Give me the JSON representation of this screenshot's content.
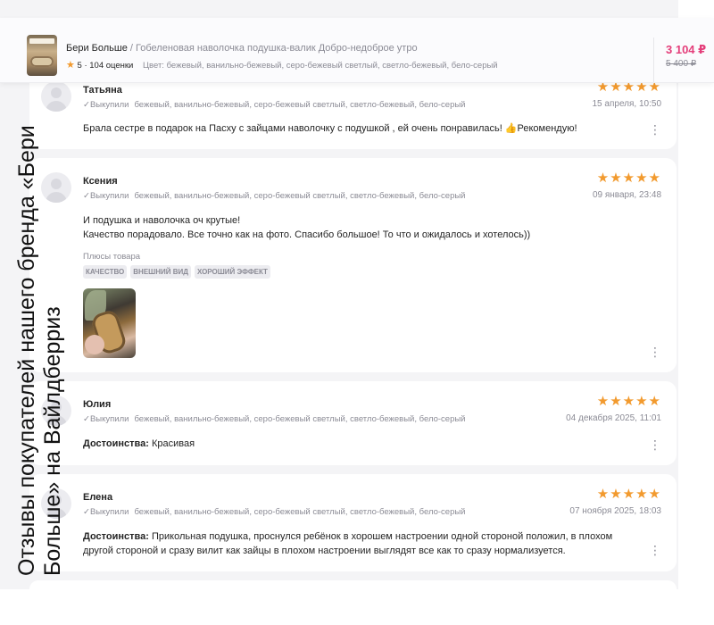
{
  "header": {
    "brand": "Бери Больше",
    "separator": " / ",
    "product": "Гобеленовая наволочка подушка-валик Добро-недоброе утро",
    "rating_star": "★",
    "rating": "5",
    "rating_dot": " · ",
    "reviews_count": "104 оценки",
    "color_label": "Цвет: бежевый, ванильно-бежевый, серо-бежевый светлый, светло-бежевый, бело-серый",
    "price": "3 104 ₽",
    "old_price": "5 400 ₽"
  },
  "reviews": [
    {
      "name": "Татьяна",
      "stars": "★★★★★",
      "bought_check": "✓",
      "bought": "Выкупили",
      "colors": "бежевый, ванильно-бежевый, серо-бежевый светлый, светло-бежевый, бело-серый",
      "date": "15 апреля, 10:50",
      "text": "Брала сестре в подарок на Пасху с зайцами наволочку с подушкой , ей очень понравилась! 👍Рекомендую!",
      "menu": "⋮"
    },
    {
      "name": "Ксения",
      "stars": "★★★★★",
      "bought_check": "✓",
      "bought": "Выкупили",
      "colors": "бежевый, ванильно-бежевый, серо-бежевый светлый, светло-бежевый, бело-серый",
      "date": "09 января, 23:48",
      "text_line1": "И подушка и наволочка оч крутые!",
      "text_line2": "Качество порадовало. Все точно как на фото. Спасибо большое! То что и ожидалось и хотелось))",
      "pros_label": "Плюсы товара",
      "tags": [
        "Качество",
        "Внешний вид",
        "Хороший эффект"
      ],
      "menu": "⋮"
    },
    {
      "name": "Юлия",
      "stars": "★★★★★",
      "bought_check": "✓",
      "bought": "Выкупили",
      "colors": "бежевый, ванильно-бежевый, серо-бежевый светлый, светло-бежевый, бело-серый",
      "date": "04 декабря 2025, 11:01",
      "adv_label": "Достоинства:",
      "adv_text": " Красивая",
      "menu": "⋮"
    },
    {
      "name": "Елена",
      "stars": "★★★★★",
      "bought_check": "✓",
      "bought": "Выкупили",
      "colors": "бежевый, ванильно-бежевый, серо-бежевый светлый, светло-бежевый, бело-серый",
      "date": "07 ноября 2025, 18:03",
      "adv_label": "Достоинства:",
      "adv_text": " Прикольная подушка, проснулся ребёнок в хорошем настроении одной стороной положил, в плохом другой стороной и сразу вилит как зайцы в плохом настроении выглядят все как то сразу нормализуется.",
      "menu": "⋮"
    }
  ],
  "overlay": {
    "line1": "Отзывы покупателей нашего бренда «Бери",
    "line2": "Больше» на Вайлдберриз"
  }
}
